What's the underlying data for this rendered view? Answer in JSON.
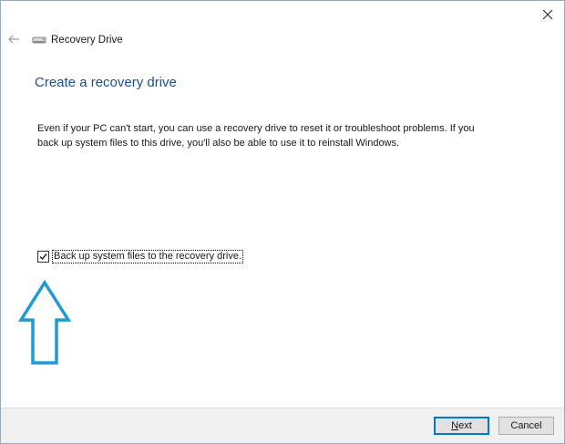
{
  "window": {
    "title": "Recovery Drive",
    "back_icon": "back-arrow-icon",
    "close_icon": "close-icon",
    "app_icon": "drive-icon"
  },
  "page": {
    "heading": "Create a recovery drive",
    "description": "Even if your PC can't start, you can use a recovery drive to reset it or troubleshoot problems. If you back up system files to this drive, you'll also be able to use it to reinstall Windows.",
    "backup_checkbox": {
      "label": "Back up system files to the recovery drive.",
      "checked": true
    },
    "annotation_icon": "up-arrow-icon",
    "annotation_color": "#1e9ad6"
  },
  "footer": {
    "next_label": "Next",
    "cancel_label": "Cancel"
  },
  "colors": {
    "heading": "#1e4e8c",
    "accent": "#0078d7",
    "footer_bg": "#f0f0f0"
  }
}
